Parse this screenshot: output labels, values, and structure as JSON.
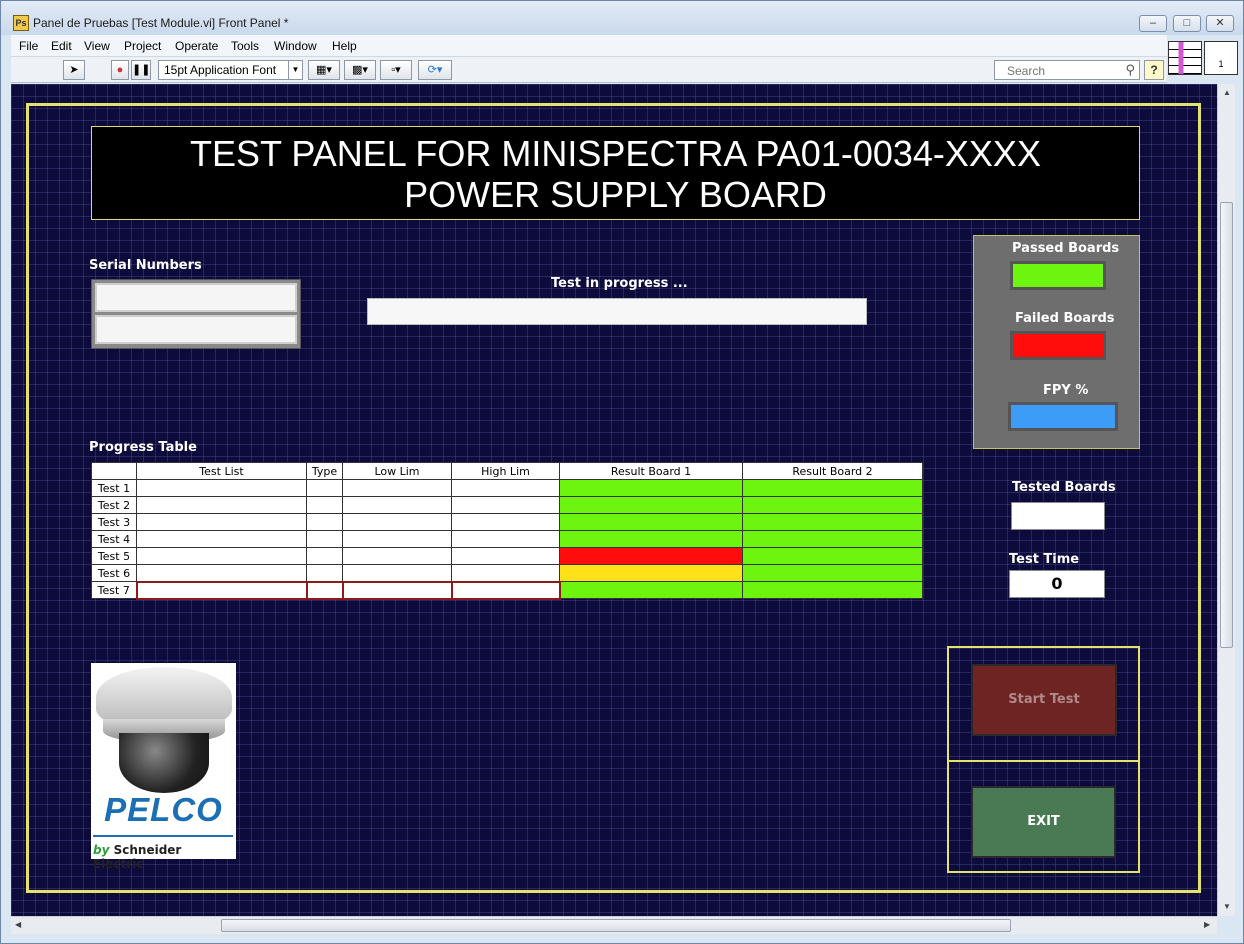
{
  "window": {
    "title": "Panel de Pruebas [Test Module.vi] Front Panel *",
    "app_icon_letters": "Ps"
  },
  "menu": [
    "File",
    "Edit",
    "View",
    "Project",
    "Operate",
    "Tools",
    "Window",
    "Help"
  ],
  "toolbar": {
    "font_select": "15pt Application Font",
    "search_placeholder": "Search",
    "help_label": "?"
  },
  "panel": {
    "title_line1": "TEST PANEL FOR MINISPECTRA PA01-0034-XXXX",
    "title_line2": "POWER SUPPLY BOARD",
    "serial_label": "Serial Numbers",
    "progress_label": "Test in progress ...",
    "progress_table_label": "Progress Table",
    "passed_label": "Passed Boards",
    "failed_label": "Failed Boards",
    "fpy_label": "FPY %",
    "tested_label": "Tested Boards",
    "test_time_label": "Test  Time",
    "test_time_value": "0",
    "start_button": "Start Test",
    "exit_button": "EXIT"
  },
  "colors": {
    "passed": "#6ef50f",
    "failed": "#ff0d0d",
    "fpy": "#3d9cf5",
    "panel_bg": "#0d0a3c",
    "frame": "#e3e26a",
    "start_btn": "#7a2a2a",
    "exit_btn": "#4a7a54",
    "result_pass": "#6ef50f",
    "result_fail": "#ff0d0d",
    "result_warn": "#ffe119"
  },
  "table": {
    "columns": [
      "Test List",
      "Type",
      "Low Lim",
      "High Lim",
      "Result Board 1",
      "Result Board 2"
    ],
    "rows": [
      {
        "name": "Test 1",
        "r1": "pass",
        "r2": "pass"
      },
      {
        "name": "Test 2",
        "r1": "pass",
        "r2": "pass"
      },
      {
        "name": "Test 3",
        "r1": "pass",
        "r2": "pass"
      },
      {
        "name": "Test 4",
        "r1": "pass",
        "r2": "pass"
      },
      {
        "name": "Test 5",
        "r1": "fail",
        "r2": "pass"
      },
      {
        "name": "Test 6",
        "r1": "warn",
        "r2": "pass"
      },
      {
        "name": "Test 7",
        "r1": "pass",
        "r2": "pass"
      }
    ]
  },
  "logo": {
    "brand": "PELCO",
    "by": "by",
    "company": "Schneider Electric"
  }
}
